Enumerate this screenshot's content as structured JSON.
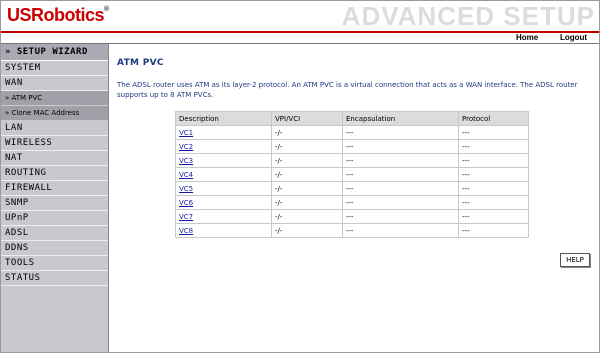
{
  "header": {
    "brand": "USRobotics",
    "brand_mark": "®",
    "title": "ADVANCED SETUP",
    "nav_home": "Home",
    "nav_logout": "Logout"
  },
  "colors": {
    "brand_red": "#cc0000",
    "sidebar_bg": "#c8c9cf",
    "title_blue": "#1f3a80",
    "link_blue": "#1a1aa6"
  },
  "sidebar": {
    "setup_wizard": "» SETUP WIZARD",
    "items": [
      "SYSTEM",
      "WAN",
      "» ATM PVC",
      "» Clone MAC Address",
      "LAN",
      "WIRELESS",
      "NAT",
      "ROUTING",
      "FIREWALL",
      "SNMP",
      "UPnP",
      "ADSL",
      "DDNS",
      "TOOLS",
      "STATUS"
    ]
  },
  "main": {
    "title": "ATM PVC",
    "description": "The ADSL router uses ATM as its layer-2 protocol. An ATM PVC is a virtual connection that acts as a WAN interface. The ADSL router supports up to 8 ATM PVCs.",
    "table": {
      "headers": [
        "Description",
        "VPI/VCI",
        "Encapsulation",
        "Protocol"
      ],
      "rows": [
        [
          "VC1",
          "-/-",
          "---",
          "---"
        ],
        [
          "VC2",
          "-/-",
          "---",
          "---"
        ],
        [
          "VC3",
          "-/-",
          "---",
          "---"
        ],
        [
          "VC4",
          "-/-",
          "---",
          "---"
        ],
        [
          "VC5",
          "-/-",
          "---",
          "---"
        ],
        [
          "VC6",
          "-/-",
          "---",
          "---"
        ],
        [
          "VC7",
          "-/-",
          "---",
          "---"
        ],
        [
          "VC8",
          "-/-",
          "---",
          "---"
        ]
      ]
    },
    "help_label": "HELP"
  }
}
